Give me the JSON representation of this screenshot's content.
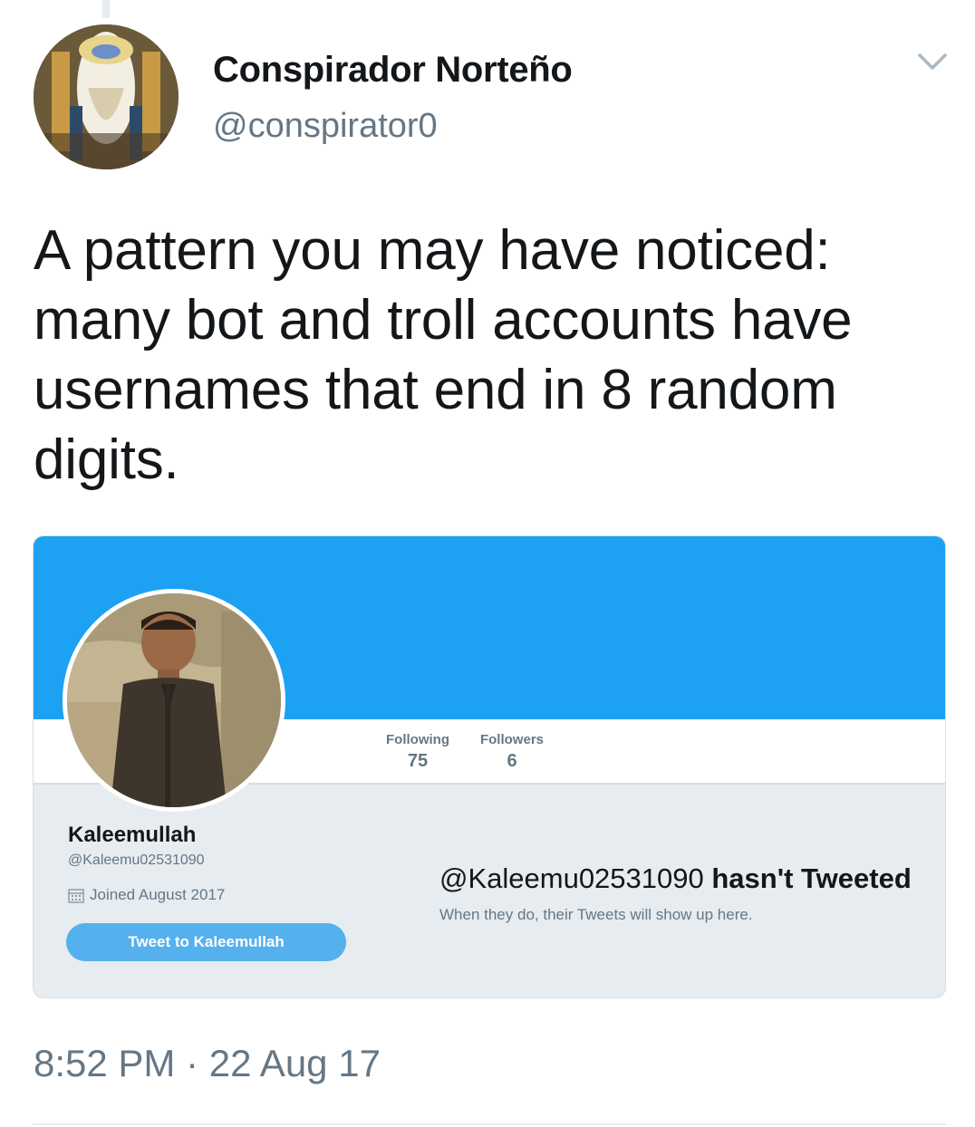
{
  "tweet": {
    "author_name": "Conspirador Norteño",
    "author_handle": "@conspirator0",
    "text": "A pattern you may have noticed: many bot and troll accounts have usernames that end in 8 random digits.",
    "timestamp": "8:52 PM · 22 Aug 17"
  },
  "embedded_profile": {
    "name": "Kaleemullah",
    "handle": "@Kaleemu02531090",
    "joined": "Joined August 2017",
    "tweet_to_label": "Tweet to Kaleemullah",
    "stats": {
      "following_label": "Following",
      "following_value": "75",
      "followers_label": "Followers",
      "followers_value": "6"
    },
    "empty_state": {
      "handle": "@Kaleemu02531090",
      "title_suffix": "hasn't Tweeted",
      "subtitle": "When they do, their Tweets will show up here."
    }
  },
  "colors": {
    "banner": "#1da1f2",
    "card_background": "#e6ecf0",
    "tweet_to_button": "#55b0ee",
    "secondary_text": "#657786"
  },
  "icons": [
    "avatar-image",
    "chevron-down-icon",
    "calendar-icon",
    "profile-photo"
  ]
}
